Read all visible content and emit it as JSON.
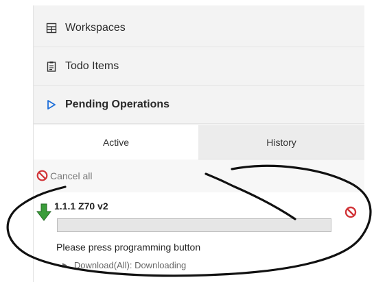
{
  "nav": {
    "workspaces": {
      "label": "Workspaces",
      "icon": "workspaces-grid-icon"
    },
    "todo": {
      "label": "Todo Items",
      "icon": "clipboard-icon"
    },
    "pending": {
      "label": "Pending Operations",
      "icon": "expand-triangle-icon"
    }
  },
  "tabs": {
    "active": "Active",
    "history": "History"
  },
  "cancel_all": {
    "label": "Cancel all",
    "icon": "cancel-icon"
  },
  "operation": {
    "title": "1.1.1 Z70 v2",
    "progress": 0,
    "status": "Please press programming button",
    "detail": "Download(All): Downloading",
    "icon": "download-arrow-icon",
    "cancel_icon": "cancel-icon"
  },
  "colors": {
    "accent_blue": "#1e6fd9",
    "cancel_red": "#d13438",
    "download_green": "#3a9d3a",
    "annotation_ink": "#111111"
  }
}
